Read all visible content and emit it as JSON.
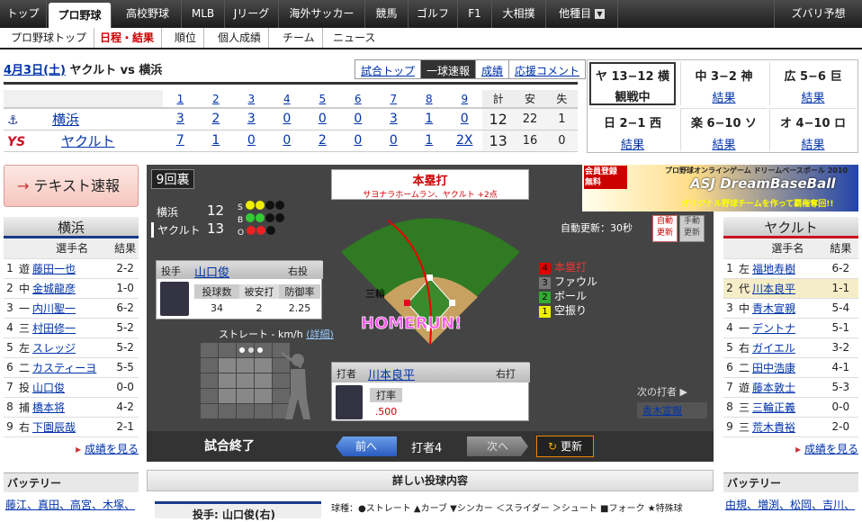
{
  "topnav": [
    "トップ",
    "プロ野球",
    "高校野球",
    "MLB",
    "Jリーグ",
    "海外サッカー",
    "競馬",
    "ゴルフ",
    "F1",
    "大相撲",
    "他種目",
    "ズバリ予想"
  ],
  "subnav": [
    "プロ野球トップ",
    "日程・結果",
    "順位",
    "個人成績",
    "チーム",
    "ニュース"
  ],
  "game": {
    "date": "4月3日(土)",
    "matchup": "ヤクルト vs 横浜",
    "tabs": [
      "試合トップ",
      "一球速報",
      "成績",
      "応援コメント"
    ]
  },
  "score": {
    "innings": [
      "1",
      "2",
      "3",
      "4",
      "5",
      "6",
      "7",
      "8",
      "9",
      "計",
      "安",
      "失"
    ],
    "teams": [
      {
        "name": "横浜",
        "runs": [
          "3",
          "2",
          "3",
          "0",
          "0",
          "0",
          "3",
          "1",
          "0"
        ],
        "total": "12",
        "hits": "22",
        "err": "1"
      },
      {
        "name": "ヤクルト",
        "runs": [
          "7",
          "1",
          "0",
          "0",
          "2",
          "0",
          "0",
          "1",
          "2X"
        ],
        "total": "13",
        "hits": "16",
        "err": "0"
      }
    ]
  },
  "others": [
    {
      "score": "ヤ 13−12 横",
      "status": "観戦中"
    },
    {
      "score": "中 3−2 神",
      "status": "結果"
    },
    {
      "score": "広 5−6 巨",
      "status": "結果"
    },
    {
      "score": "日 2−1 西",
      "status": "結果"
    },
    {
      "score": "楽 6−10 ソ",
      "status": "結果"
    },
    {
      "score": "オ 4−10 ロ",
      "status": "結果"
    }
  ],
  "text_live": "テキスト速報",
  "inning": "9回裏",
  "mini": [
    {
      "team": "横浜",
      "score": "12"
    },
    {
      "team": "ヤクルト",
      "score": "13"
    }
  ],
  "sbo": [
    "S",
    "B",
    "O"
  ],
  "play": {
    "title": "本塁打",
    "desc": "サヨナラホームラン、ヤクルト +2点",
    "runner": "三輪",
    "homerun": "HOMERUN!"
  },
  "auto": {
    "label": "自動更新：30秒",
    "auto_btn": "自動\n更新",
    "manual_btn": "手動\n更新"
  },
  "legend": [
    {
      "n": "4",
      "t": "本塁打",
      "c": "#d00"
    },
    {
      "n": "3",
      "t": "ファウル",
      "c": "#777"
    },
    {
      "n": "2",
      "t": "ボール",
      "c": "#3a3"
    },
    {
      "n": "1",
      "t": "空振り",
      "c": "#ee0"
    }
  ],
  "pitcher": {
    "role": "投手",
    "name": "山口俊",
    "hand": "右投",
    "cols": [
      "投球数",
      "被安打",
      "防御率"
    ],
    "vals": [
      "34",
      "2",
      "2.25"
    ]
  },
  "pitch": {
    "label": "ストレート - km/h",
    "detail": "(詳細)"
  },
  "batter": {
    "role": "打者",
    "name": "川本良平",
    "hand": "右打",
    "col": "打率",
    "val": ".500"
  },
  "next": {
    "label": "次の打者 ▶",
    "name": "青木宣親"
  },
  "controls": {
    "status": "試合終了",
    "prev": "前へ",
    "batter": "打者4",
    "next": "次へ",
    "refresh": "更新"
  },
  "detail_title": "詳しい投球内容",
  "pitch_types": "球種：●ストレート ▲カーブ ▼シンカー ＜スライダー ＞シュート ■フォーク ★特殊球",
  "pitcher_line": "投手: 山口俊(右)",
  "ad": {
    "top": "会員登録 無料",
    "title": "プロ野球オンラインゲーム ドリームベースボール 2010",
    "brand": "ASJ DreamBaseBall",
    "sub": "オリジナル野球チームを作って覇権奪回!!"
  },
  "left": {
    "team": "横浜",
    "hdr": [
      "選手名",
      "結果"
    ],
    "rows": [
      [
        "1",
        "遊",
        "藤田一也",
        "2-2"
      ],
      [
        "2",
        "中",
        "金城龍彦",
        "1-0"
      ],
      [
        "3",
        "一",
        "内川聖一",
        "6-2"
      ],
      [
        "4",
        "三",
        "村田修一",
        "5-2"
      ],
      [
        "5",
        "左",
        "スレッジ",
        "5-2"
      ],
      [
        "6",
        "二",
        "カスティーヨ",
        "5-5"
      ],
      [
        "7",
        "投",
        "山口俊",
        "0-0"
      ],
      [
        "8",
        "捕",
        "橋本将",
        "4-2"
      ],
      [
        "9",
        "右",
        "下園辰哉",
        "2-1"
      ]
    ],
    "more": "成績を見る",
    "battery": "バッテリー",
    "battery_text": "藤江、真田、高宮、木塚、"
  },
  "right": {
    "team": "ヤクルト",
    "hdr": [
      "選手名",
      "結果"
    ],
    "rows": [
      [
        "1",
        "左",
        "福地寿樹",
        "6-2"
      ],
      [
        "2",
        "代",
        "川本良平",
        "1-1"
      ],
      [
        "3",
        "中",
        "青木宣親",
        "5-4"
      ],
      [
        "4",
        "一",
        "デントナ",
        "5-1"
      ],
      [
        "5",
        "右",
        "ガイエル",
        "3-2"
      ],
      [
        "6",
        "二",
        "田中浩康",
        "4-1"
      ],
      [
        "7",
        "遊",
        "藤本敦士",
        "5-3"
      ],
      [
        "8",
        "三",
        "三輪正義",
        "0-0"
      ],
      [
        "9",
        "三",
        "荒木貴裕",
        "2-0"
      ]
    ],
    "more": "成績を見る",
    "battery": "バッテリー",
    "battery_text": "由規、増渕、松岡、吉川、"
  },
  "colors": {
    "team_yokohama": "#1a3a8a",
    "team_yakult": "#cc1122",
    "accent": "#cc0000"
  }
}
